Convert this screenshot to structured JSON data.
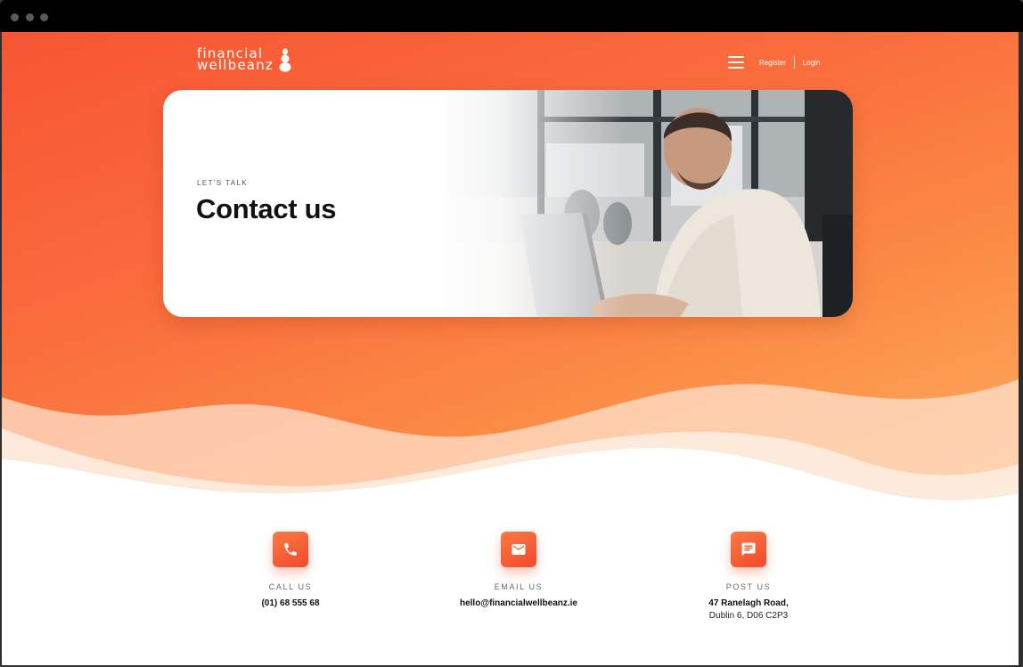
{
  "brand": {
    "line1": "financial",
    "line2": "wellbeanz"
  },
  "nav": {
    "register": "Register",
    "login": "Login"
  },
  "hero": {
    "kicker": "LET'S TALK",
    "title": "Contact us"
  },
  "contacts": [
    {
      "label": "CALL US",
      "value": "(01) 68 555 68",
      "value2": "",
      "icon": "phone-icon"
    },
    {
      "label": "EMAIL US",
      "value": "hello@financialwellbeanz.ie",
      "value2": "",
      "icon": "mail-icon"
    },
    {
      "label": "POST US",
      "value": "47 Ranelagh Road,",
      "value2": "Dublin 6, D06 C2P3",
      "icon": "chat-icon"
    }
  ],
  "colors": {
    "accent": "#f75533",
    "accent_light": "#fdb060",
    "text_dark": "#111111"
  }
}
